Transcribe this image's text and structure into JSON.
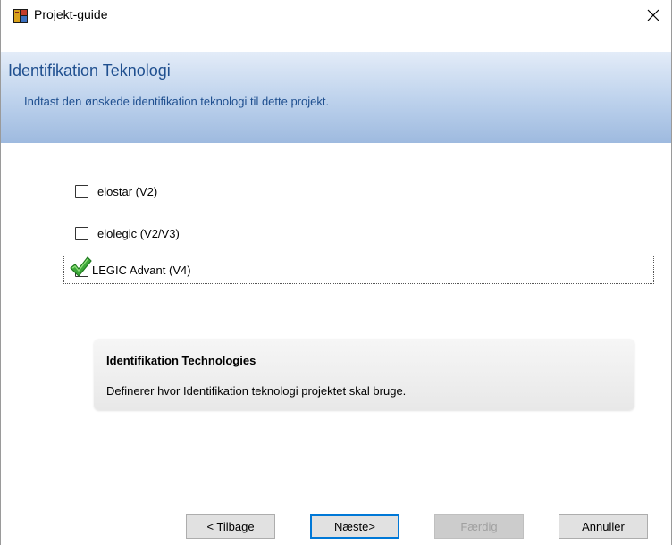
{
  "window": {
    "title": "Projekt-guide"
  },
  "header": {
    "title": "Identifikation Teknologi",
    "subtitle": "Indtast den ønskede identifikation teknologi til dette projekt."
  },
  "options": [
    {
      "label": "elostar (V2)",
      "checked": false
    },
    {
      "label": "elolegic (V2/V3)",
      "checked": false
    },
    {
      "label": "LEGIC Advant (V4)",
      "checked": true
    }
  ],
  "info": {
    "title": "Identifikation Technologies",
    "text": "Definerer hvor Identifikation teknologi projektet skal bruge."
  },
  "buttons": {
    "back": "< Tilbage",
    "next": "Næste>",
    "finish": "Færdig",
    "cancel": "Annuller"
  },
  "icons": {
    "app": "app-icon",
    "close": "close-icon",
    "check": "checkmark-icon"
  },
  "colors": {
    "header_text": "#1f4f8f",
    "check_green": "#3da83a",
    "primary_border": "#0078d7"
  }
}
